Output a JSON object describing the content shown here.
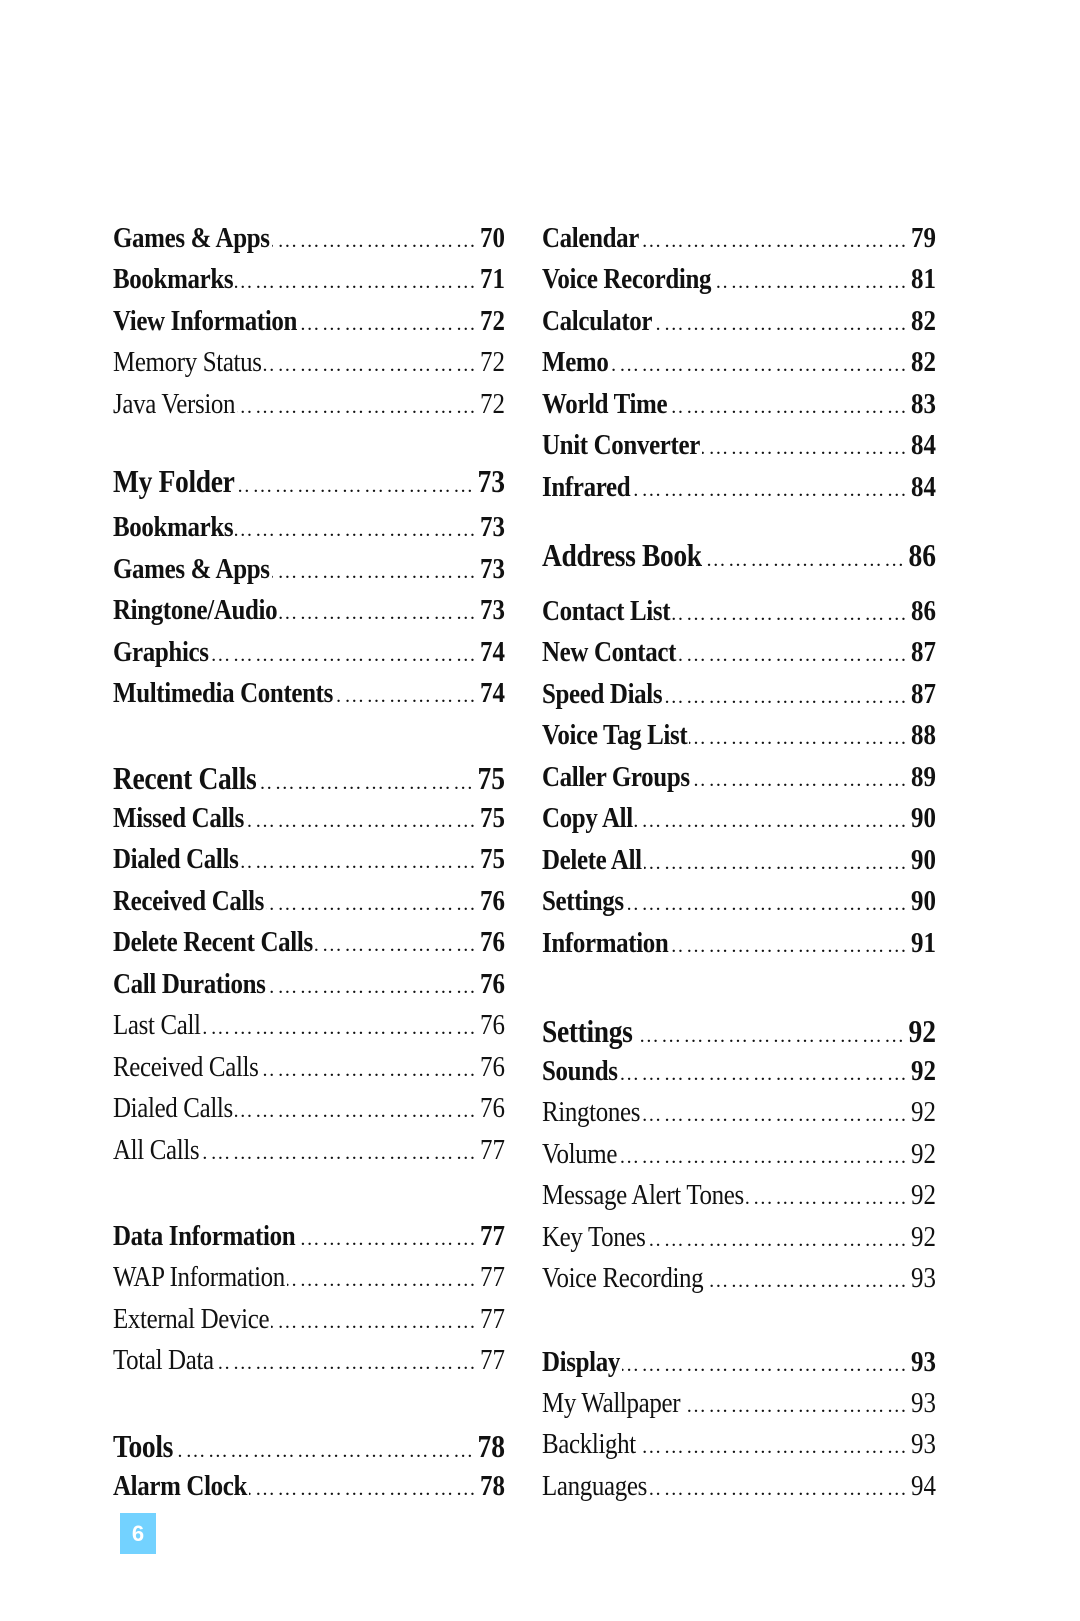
{
  "toc": {
    "left": [
      {
        "label": "Games & Apps",
        "page": "70",
        "style": "item"
      },
      {
        "label": "Bookmarks",
        "page": "71",
        "style": "item"
      },
      {
        "label": "View Information",
        "page": "72",
        "style": "item"
      },
      {
        "label": "Memory Status",
        "page": "72",
        "style": "sub"
      },
      {
        "label": "Java Version",
        "page": "72",
        "style": "sub"
      },
      {
        "label": "My Folder",
        "page": "73",
        "style": "heading"
      },
      {
        "label": "Bookmarks",
        "page": "73",
        "style": "item"
      },
      {
        "label": "Games & Apps",
        "page": "73",
        "style": "item"
      },
      {
        "label": "Ringtone/Audio",
        "page": "73",
        "style": "item"
      },
      {
        "label": "Graphics",
        "page": "74",
        "style": "item"
      },
      {
        "label": "Multimedia Contents",
        "page": "74",
        "style": "item"
      },
      {
        "label": "Recent Calls",
        "page": "75",
        "style": "heading"
      },
      {
        "label": "Missed Calls",
        "page": "75",
        "style": "item"
      },
      {
        "label": "Dialed Calls",
        "page": "75",
        "style": "item"
      },
      {
        "label": "Received Calls",
        "page": "76",
        "style": "item"
      },
      {
        "label": "Delete Recent Calls",
        "page": "76",
        "style": "item"
      },
      {
        "label": "Call Durations",
        "page": "76",
        "style": "item"
      },
      {
        "label": "Last Call",
        "page": "76",
        "style": "sub"
      },
      {
        "label": "Received Calls",
        "page": "76",
        "style": "sub"
      },
      {
        "label": "Dialed Calls",
        "page": "76",
        "style": "sub"
      },
      {
        "label": "All Calls",
        "page": "77",
        "style": "sub"
      },
      {
        "label": "Data Information",
        "page": "77",
        "style": "item"
      },
      {
        "label": "WAP Information",
        "page": "77",
        "style": "sub"
      },
      {
        "label": "External Device",
        "page": "77",
        "style": "sub"
      },
      {
        "label": "Total Data",
        "page": "77",
        "style": "sub"
      },
      {
        "label": "Tools",
        "page": "78",
        "style": "heading"
      },
      {
        "label": "Alarm Clock",
        "page": "78",
        "style": "item"
      }
    ],
    "right": [
      {
        "label": "Calendar",
        "page": "79",
        "style": "item"
      },
      {
        "label": "Voice Recording",
        "page": "81",
        "style": "item"
      },
      {
        "label": "Calculator",
        "page": "82",
        "style": "item"
      },
      {
        "label": "Memo",
        "page": "82",
        "style": "item"
      },
      {
        "label": "World Time",
        "page": "83",
        "style": "item"
      },
      {
        "label": "Unit Converter",
        "page": "84",
        "style": "item"
      },
      {
        "label": "Infrared",
        "page": "84",
        "style": "item"
      },
      {
        "label": "Address Book",
        "page": "86",
        "style": "heading"
      },
      {
        "label": "Contact List",
        "page": "86",
        "style": "item"
      },
      {
        "label": "New Contact",
        "page": "87",
        "style": "item"
      },
      {
        "label": "Speed Dials",
        "page": "87",
        "style": "item"
      },
      {
        "label": "Voice Tag List",
        "page": "88",
        "style": "item"
      },
      {
        "label": "Caller Groups",
        "page": "89",
        "style": "item"
      },
      {
        "label": "Copy All",
        "page": "90",
        "style": "item"
      },
      {
        "label": "Delete All",
        "page": "90",
        "style": "item"
      },
      {
        "label": "Settings",
        "page": "90",
        "style": "item"
      },
      {
        "label": "Information",
        "page": "91",
        "style": "item"
      },
      {
        "label": "Settings",
        "page": "92",
        "style": "heading"
      },
      {
        "label": "Sounds",
        "page": "92",
        "style": "item"
      },
      {
        "label": "Ringtones",
        "page": "92",
        "style": "sub"
      },
      {
        "label": "Volume",
        "page": "92",
        "style": "sub"
      },
      {
        "label": "Message Alert Tones",
        "page": "92",
        "style": "sub"
      },
      {
        "label": "Key Tones",
        "page": "92",
        "style": "sub"
      },
      {
        "label": "Voice Recording",
        "page": "93",
        "style": "sub"
      },
      {
        "label": "Display",
        "page": "93",
        "style": "item"
      },
      {
        "label": "My Wallpaper",
        "page": "93",
        "style": "sub"
      },
      {
        "label": "Backlight",
        "page": "93",
        "style": "sub"
      },
      {
        "label": "Languages",
        "page": "94",
        "style": "sub"
      }
    ],
    "leader": "……………………………………………………………………"
  },
  "footer": {
    "page_number": "6",
    "badge_color": "#73D2FF"
  }
}
